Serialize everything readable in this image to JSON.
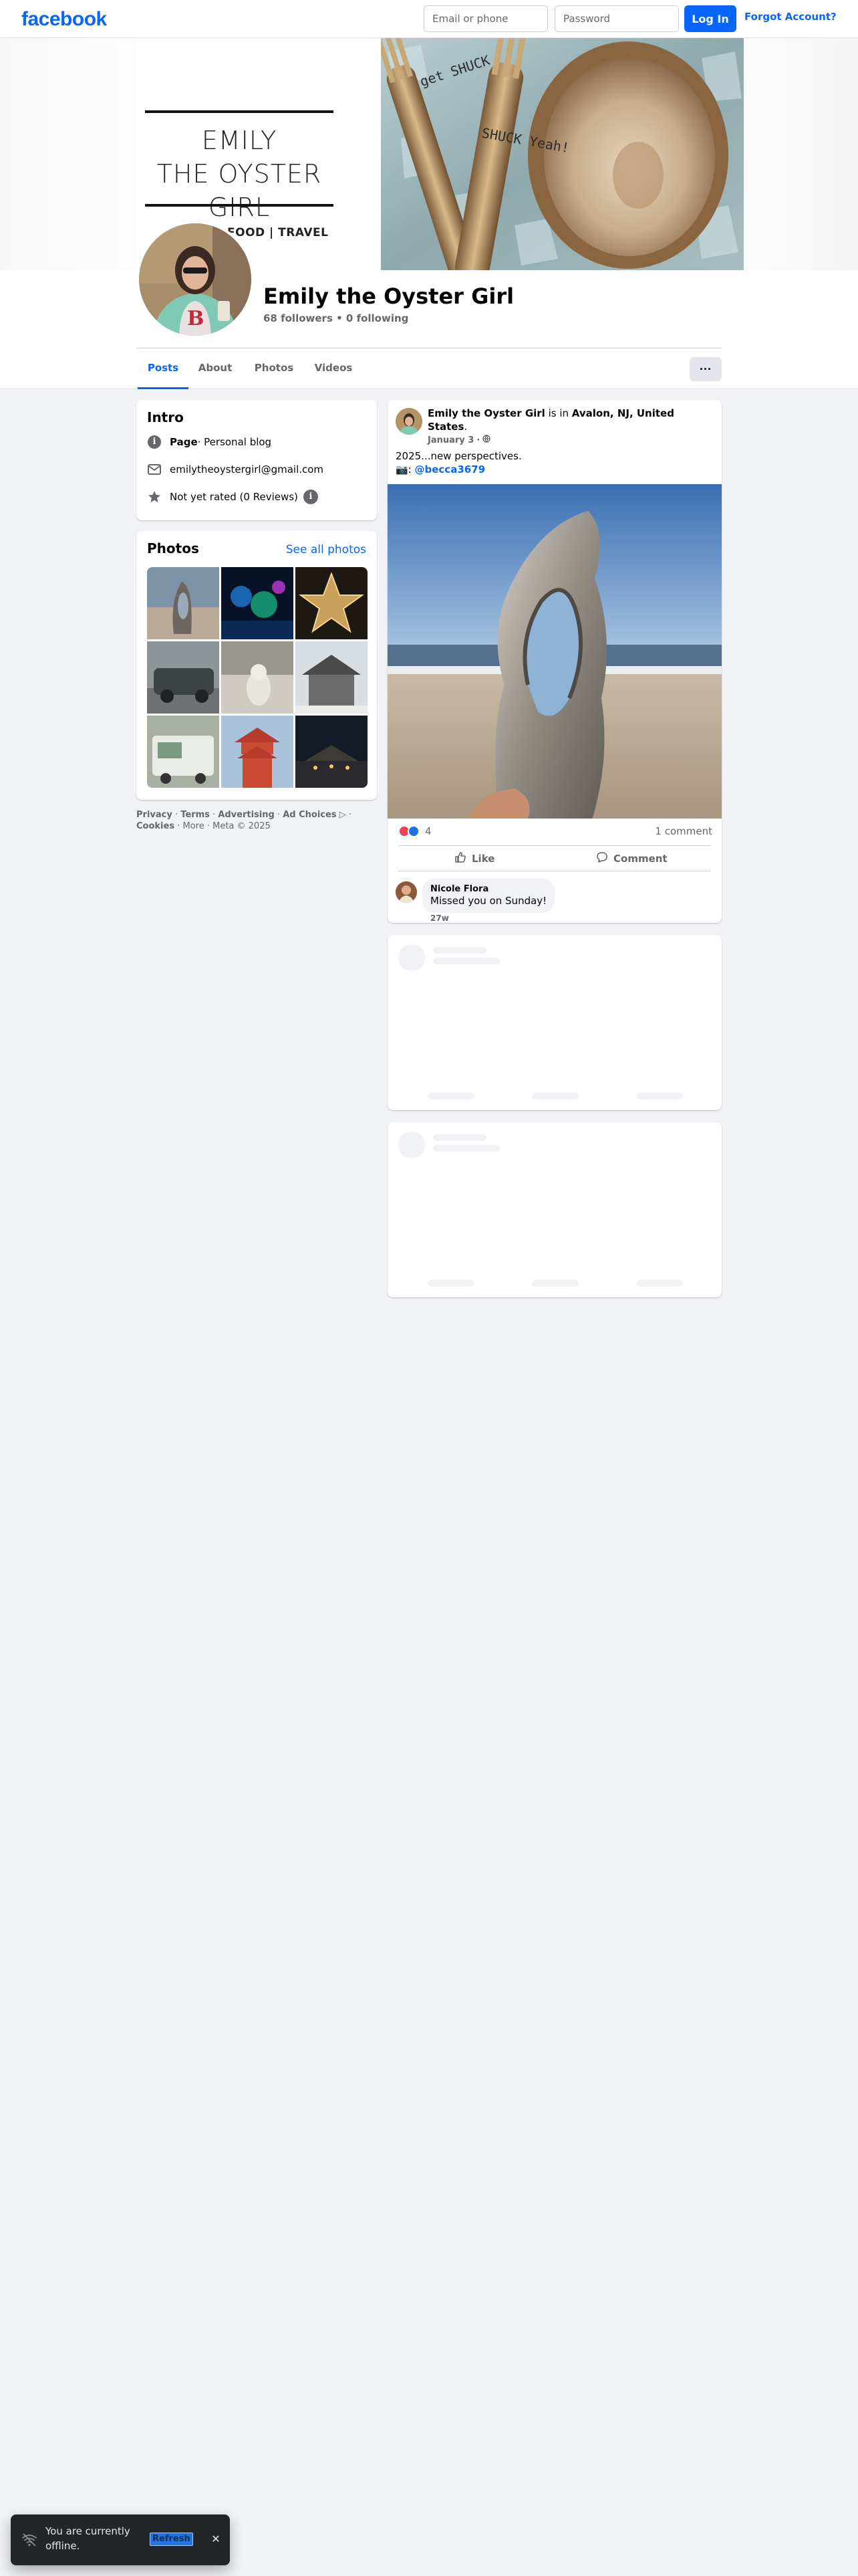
{
  "topbar": {
    "logo": "facebook",
    "email_placeholder": "Email or phone",
    "password_placeholder": "Password",
    "login_label": "Log In",
    "forgot_label": "Forgot Account?"
  },
  "cover": {
    "title_line1": "EMILY",
    "title_line2": "THE OYSTER GIRL",
    "tagline": "FOOD | TRAVEL",
    "fork_text_1": "get SHUCK",
    "fork_text_2": "SHUCK Yeah!"
  },
  "profile": {
    "name": "Emily the Oyster Girl",
    "stats": "68 followers • 0 following"
  },
  "tabs": [
    {
      "label": "Posts",
      "active": true
    },
    {
      "label": "About"
    },
    {
      "label": "Photos"
    },
    {
      "label": "Videos"
    }
  ],
  "more_label": "···",
  "intro": {
    "heading": "Intro",
    "category_bold": "Page",
    "category_rest": " · Personal blog",
    "email": "emilytheoystergirl@gmail.com",
    "rating": "Not yet rated (0 Reviews)"
  },
  "photos": {
    "heading": "Photos",
    "see_all": "See all photos"
  },
  "footer": {
    "links": [
      "Privacy",
      "Terms",
      "Advertising",
      "Ad Choices",
      "Cookies",
      "More"
    ],
    "copyright": "Meta © 2025"
  },
  "post": {
    "author": "Emily the Oyster Girl",
    "is_in": " is in ",
    "location": "Avalon, NJ, United States",
    "location_suffix": ".",
    "date": "January 3",
    "text_line1": "2025...new perspectives.",
    "camera_prefix": "📷: ",
    "mention": "@becca3679",
    "reaction_count": "4",
    "comment_count": "1 comment",
    "like_label": "Like",
    "comment_label": "Comment",
    "comment": {
      "author": "Nicole Flora",
      "text": "Missed you on Sunday!",
      "time": "27w"
    }
  },
  "toast": {
    "text": "You are currently offline.",
    "refresh": "Refresh"
  },
  "colors": {
    "brand": "#0866ff",
    "background": "#f0f2f5",
    "secondary_text": "#65676b"
  }
}
